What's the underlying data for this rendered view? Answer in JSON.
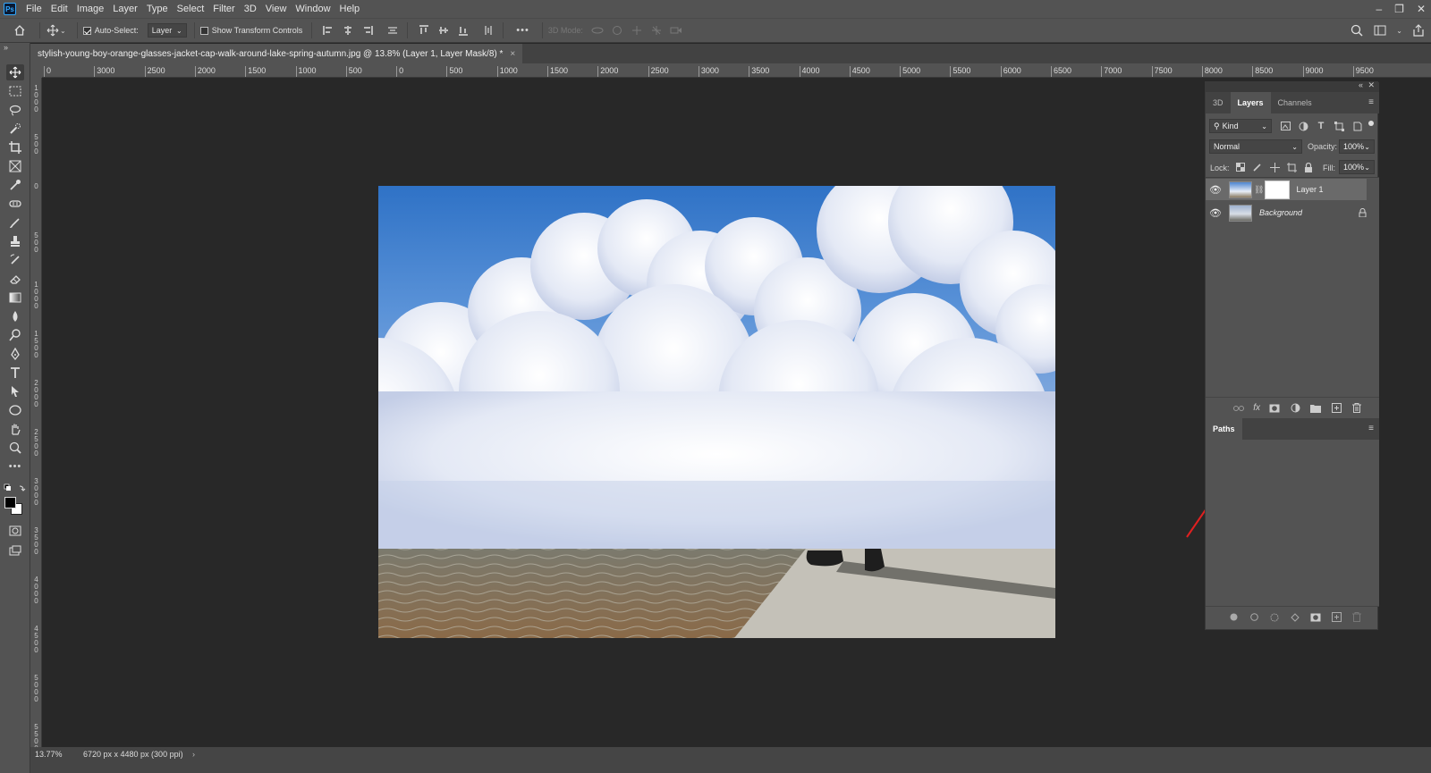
{
  "app": {
    "logo": "Ps"
  },
  "menu": [
    "File",
    "Edit",
    "Image",
    "Layer",
    "Type",
    "Select",
    "Filter",
    "3D",
    "View",
    "Window",
    "Help"
  ],
  "window_controls": {
    "minimize": "–",
    "restore": "❐",
    "close": "✕"
  },
  "options": {
    "auto_select_label": "Auto-Select:",
    "auto_select_checked": true,
    "auto_select_target": "Layer",
    "show_transform_label": "Show Transform Controls",
    "show_transform_checked": false,
    "more": "•••",
    "mode_3d_label": "3D Mode:"
  },
  "document": {
    "tab_title": "stylish-young-boy-orange-glasses-jacket-cap-walk-around-lake-spring-autumn.jpg @ 13.8% (Layer 1, Layer Mask/8) *",
    "close_icon": "×"
  },
  "ruler": {
    "h_labels": [
      "0",
      "3000",
      "2500",
      "2000",
      "1500",
      "1000",
      "500",
      "0",
      "500",
      "1000",
      "1500",
      "2000",
      "2500",
      "3000",
      "3500",
      "4000",
      "4500",
      "5000",
      "5500",
      "6000",
      "6500",
      "7000",
      "7500",
      "8000",
      "8500",
      "9000",
      "9500"
    ],
    "v_labels": [
      "1\n0\n0\n0",
      "5\n0\n0",
      "0",
      "5\n0\n0",
      "1\n0\n0\n0",
      "1\n5\n0\n0",
      "2\n0\n0\n0",
      "2\n5\n0\n0",
      "3\n0\n0\n0",
      "3\n5\n0\n0",
      "4\n0\n0\n0",
      "4\n5\n0\n0",
      "5\n0\n0\n0",
      "5\n5\n0\n0"
    ]
  },
  "status": {
    "zoom": "13.77%",
    "doc_info": "6720 px x 4480 px (300 ppi)",
    "arrow": "›"
  },
  "panels": {
    "top_tabs": [
      "3D",
      "Layers",
      "Channels"
    ],
    "active_tab": "Layers",
    "filter_kind": "Kind",
    "blend_mode": "Normal",
    "opacity_label": "Opacity:",
    "opacity_value": "100%",
    "lock_label": "Lock:",
    "fill_label": "Fill:",
    "fill_value": "100%",
    "layers": [
      {
        "name": "Layer 1",
        "visible": true,
        "has_mask": true,
        "selected": true,
        "italic": false,
        "locked": false
      },
      {
        "name": "Background",
        "visible": true,
        "has_mask": false,
        "selected": false,
        "italic": true,
        "locked": true
      }
    ],
    "paths_tab": "Paths",
    "layer_footer_icons": [
      "link-icon",
      "fx-icon",
      "add-mask-icon",
      "adjustment-icon",
      "folder-icon",
      "new-layer-icon",
      "trash-icon"
    ],
    "fx_label": "fx"
  },
  "colors": {
    "annotation_arrow": "#e02020",
    "selection_accent": "#31a8ff"
  }
}
